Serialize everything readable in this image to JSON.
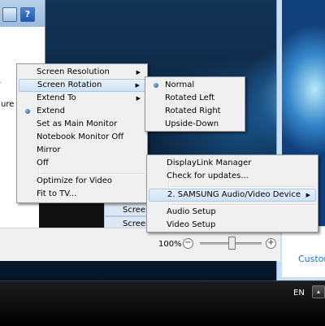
{
  "background_window": {
    "help_label": "?",
    "partial_text": "ure",
    "dots": "..",
    "screen_items": [
      "Screen",
      "Screen"
    ]
  },
  "status_bar": {
    "zoom": "100%",
    "zoom_out_label": "−",
    "zoom_in_label": "+",
    "zoom_slider_fraction": 0.5
  },
  "right_panel": {
    "link_text": "Custom"
  },
  "taskbar": {
    "language": "EN",
    "tray_button": "▴"
  },
  "main_menu": {
    "items": [
      {
        "label": "Screen Resolution",
        "submenu": true
      },
      {
        "label": "Screen Rotation",
        "submenu": true,
        "highlighted": true
      },
      {
        "label": "Extend To",
        "submenu": true
      },
      {
        "label": "Extend",
        "selected": true
      },
      {
        "label": "Set as Main Monitor"
      },
      {
        "label": "Notebook Monitor Off"
      },
      {
        "label": "Mirror"
      },
      {
        "label": "Off"
      },
      {
        "label": "Optimize for Video"
      },
      {
        "label": "Fit to TV..."
      }
    ]
  },
  "rotation_menu": {
    "items": [
      {
        "label": "Normal",
        "selected": true
      },
      {
        "label": "Rotated Left"
      },
      {
        "label": "Rotated Right"
      },
      {
        "label": "Upside-Down"
      }
    ]
  },
  "tray_menu": {
    "items": [
      {
        "label": "DisplayLink Manager"
      },
      {
        "label": "Check for updates..."
      },
      {
        "label": "2. SAMSUNG Audio/Video Device",
        "submenu": true
      },
      {
        "label": "Audio Setup"
      },
      {
        "label": "Video Setup"
      }
    ]
  },
  "colors": {
    "menu_bg": "#f0f0f0",
    "highlight": "#cfe3f8",
    "taskbar": "#000000",
    "link": "#1a73c8"
  }
}
